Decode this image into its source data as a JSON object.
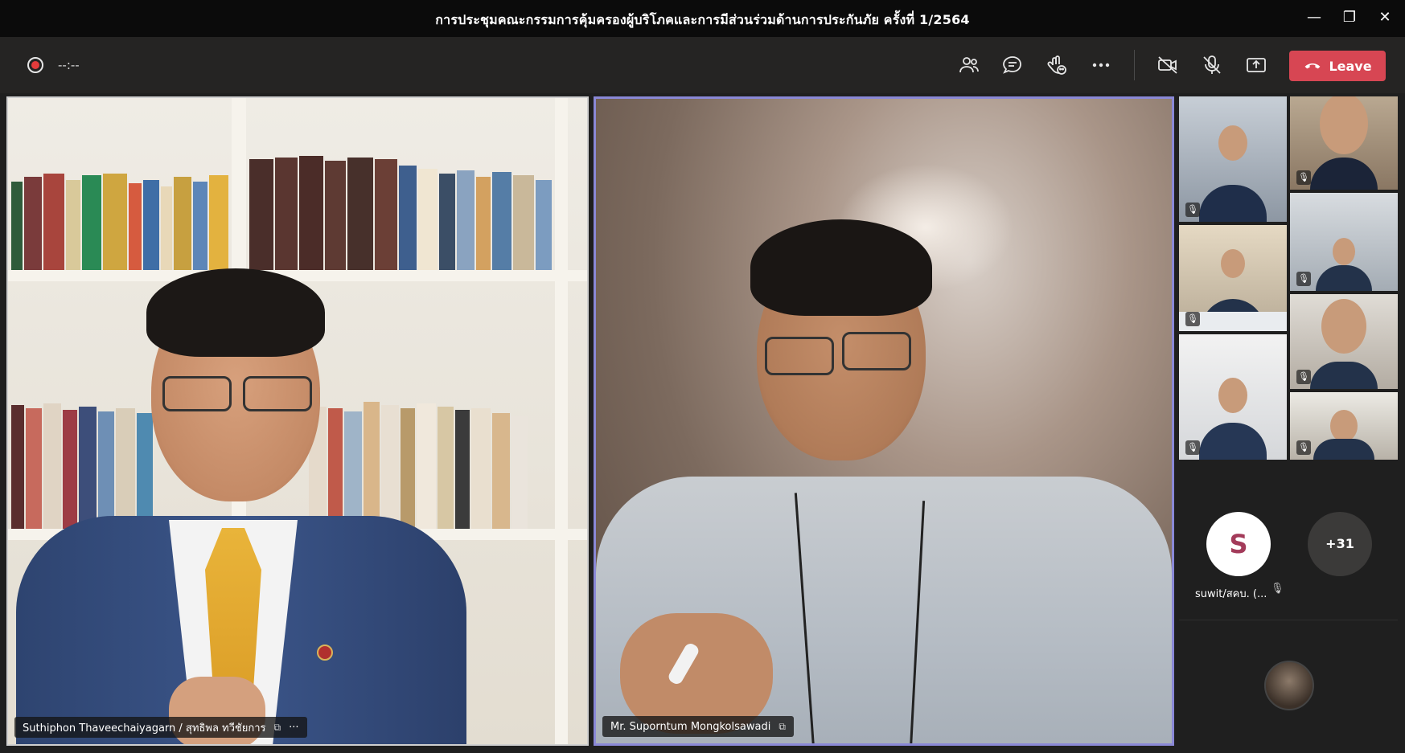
{
  "window": {
    "title": "การประชุมคณะกรรมการคุ้มครองผู้บริโภคและการมีส่วนร่วมด้านการประกันภัย ครั้งที่ 1/2564",
    "minimize": "—",
    "restore": "❐",
    "close": "✕"
  },
  "toolbar": {
    "timer": "--:--",
    "leave_label": "Leave"
  },
  "participants": {
    "main_left": {
      "name": "Suthiphon Thaveechaiyagarn / สุทธิพล ทวีชัยการ",
      "more": "···"
    },
    "main_right": {
      "name": "Mr. Suporntum Mongkolsawadi"
    },
    "avatar_s": {
      "initial": "S",
      "name": "suwit/สคบ. (..."
    },
    "more_count": "+31"
  },
  "colors": {
    "leave": "#d74653",
    "active_speaker_border": "#8a88d6",
    "toolbar_bg": "#252423",
    "titlebar_bg": "#0b0b0b"
  },
  "icons": [
    "record-icon",
    "participants-icon",
    "chat-icon",
    "reactions-icon",
    "more-actions-icon",
    "camera-off-icon",
    "mic-off-icon",
    "share-icon",
    "phone-hangup-icon",
    "muted-mic-icon",
    "raised-view-icon"
  ]
}
